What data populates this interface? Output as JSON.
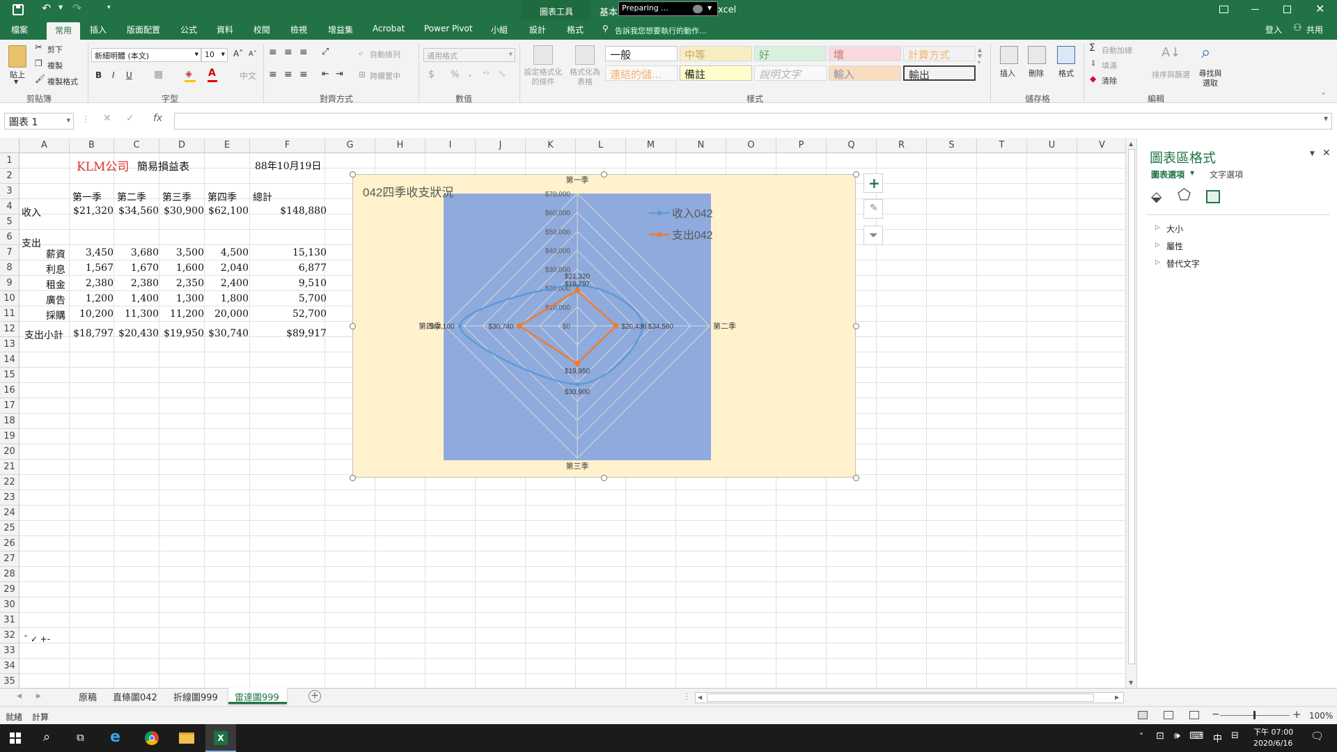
{
  "titlebar": {
    "contextual_label": "圖表工具",
    "file_prefix": "基本",
    "file_suffix": "xcel",
    "preparing": "Preparing ..."
  },
  "tabs": [
    "檔案",
    "常用",
    "插入",
    "版面配置",
    "公式",
    "資料",
    "校閱",
    "檢視",
    "增益集",
    "Acrobat",
    "Power Pivot",
    "小組",
    "設計",
    "格式"
  ],
  "tell_me": "告訴我您想要執行的動作...",
  "signin": "登入",
  "share": "共用",
  "ribbon": {
    "clipboard": {
      "paste": "貼上",
      "cut": "剪下",
      "copy": "複製",
      "format_painter": "複製格式",
      "label": "剪貼簿"
    },
    "font": {
      "name": "新細明體 (本文)",
      "size": "10",
      "label": "字型",
      "bold": "B",
      "italic": "I",
      "underline": "U"
    },
    "alignment": {
      "wrap": "自動換列",
      "merge": "跨欄置中",
      "label": "對齊方式"
    },
    "number": {
      "format": "通用格式",
      "label": "數值",
      "currency": "$",
      "percent": "%",
      "comma": ","
    },
    "conditional": "設定格式化的條件",
    "format_table": "格式化為表格",
    "styles": {
      "items": [
        "一般",
        "中等",
        "好",
        "壞",
        "計算方式",
        "連結的儲...",
        "備註",
        "說明文字",
        "輸入",
        "輸出"
      ],
      "label": "樣式"
    },
    "cells": {
      "insert": "插入",
      "delete": "刪除",
      "format": "格式",
      "label": "儲存格"
    },
    "editing": {
      "autosum": "自動加總",
      "fill": "填滿",
      "clear": "清除",
      "sort": "排序與篩選",
      "find": "尋找與選取",
      "label": "編輯"
    }
  },
  "formula": {
    "name_box": "圖表 1",
    "fx": "fx",
    "content": ""
  },
  "columns": [
    "A",
    "B",
    "C",
    "D",
    "E",
    "F",
    "G",
    "H",
    "I",
    "J",
    "K",
    "L",
    "M",
    "N",
    "O",
    "P",
    "Q",
    "R",
    "S",
    "T",
    "U",
    "V"
  ],
  "rows": [
    "1",
    "2",
    "3",
    "4",
    "5",
    "6",
    "7",
    "8",
    "9",
    "10",
    "11",
    "12",
    "13",
    "14",
    "15",
    "16",
    "17",
    "18",
    "19",
    "20",
    "21",
    "22",
    "23",
    "24",
    "25",
    "26",
    "27",
    "28",
    "29",
    "30",
    "31",
    "32",
    "33",
    "34",
    "35"
  ],
  "sheet": {
    "a1": "KLM公司",
    "c1": "簡易損益表",
    "f1": "88年10月19日",
    "headers": [
      "第一季",
      "第二季",
      "第三季",
      "第四季",
      "總計"
    ],
    "income": {
      "label": "收入",
      "values": [
        "$21,320",
        "$34,560",
        "$30,900",
        "$62,100",
        "$148,880"
      ]
    },
    "expense_label": "支出",
    "expense_rows": [
      {
        "label": "薪資",
        "values": [
          "3,450",
          "3,680",
          "3,500",
          "4,500",
          "15,130"
        ]
      },
      {
        "label": "利息",
        "values": [
          "1,567",
          "1,670",
          "1,600",
          "2,040",
          "6,877"
        ]
      },
      {
        "label": "租金",
        "values": [
          "2,380",
          "2,380",
          "2,350",
          "2,400",
          "9,510"
        ]
      },
      {
        "label": "廣告",
        "values": [
          "1,200",
          "1,400",
          "1,300",
          "1,800",
          "5,700"
        ]
      },
      {
        "label": "採購",
        "values": [
          "10,200",
          "11,300",
          "11,200",
          "20,000",
          "52,700"
        ]
      }
    ],
    "subtotal": {
      "label": "支出小計",
      "values": [
        "$18,797",
        "$20,430",
        "$19,950",
        "$30,740",
        "$89,917"
      ]
    },
    "a32": "ˇ ✓ +-"
  },
  "chart_data": {
    "type": "radar",
    "title": "042四季收支狀況",
    "categories": [
      "第一季",
      "第二季",
      "第三季",
      "第四季"
    ],
    "series": [
      {
        "name": "收入042",
        "values": [
          21320,
          34560,
          30900,
          62100
        ],
        "color": "#5b9bd5"
      },
      {
        "name": "支出042",
        "values": [
          18797,
          20430,
          19950,
          30740
        ],
        "color": "#ed7d31"
      }
    ],
    "axis_ticks": [
      "$0",
      "$10,000",
      "$20,000",
      "$30,000",
      "$40,000",
      "$50,000",
      "$60,000",
      "$70,000"
    ],
    "data_labels": {
      "income": [
        "$21,320",
        "$34,560",
        "$30,900",
        "$62,100"
      ],
      "expense": [
        "$18,797",
        "$20,430",
        "$19,950",
        "$30,740"
      ]
    },
    "ylim": [
      0,
      70000
    ],
    "plot_bg": "#8faadc",
    "chart_bg": "#fff2cc",
    "legend_position": "top-right"
  },
  "sheet_tabs": [
    "原稿",
    "直條圖042",
    "折線圖999",
    "雷達圖999"
  ],
  "active_sheet": "雷達圖999",
  "status": {
    "ready": "就緒",
    "calc": "計算",
    "zoom": "100%"
  },
  "pane": {
    "title": "圖表區格式",
    "tab1": "圖表選項",
    "tab2": "文字選項",
    "sections": [
      "大小",
      "屬性",
      "替代文字"
    ]
  },
  "taskbar": {
    "time": "下午 07:00",
    "date": "2020/6/16",
    "ime": "中"
  }
}
